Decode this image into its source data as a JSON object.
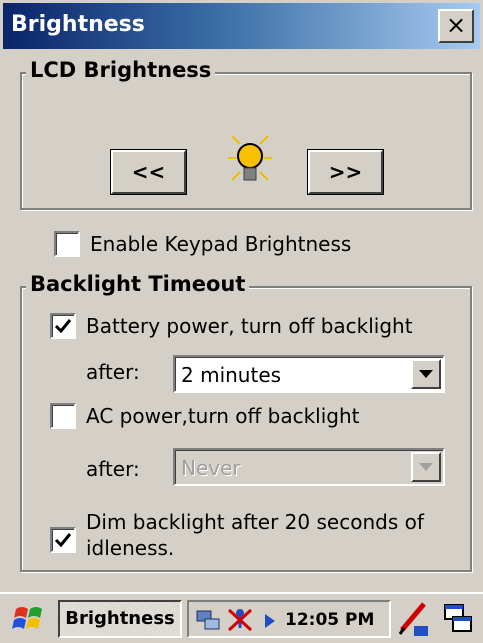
{
  "window": {
    "title": "Brightness",
    "close_label": "×"
  },
  "lcd": {
    "legend": "LCD Brightness",
    "decrease_label": "<<",
    "increase_label": ">>",
    "icon": "lightbulb-icon"
  },
  "keypad": {
    "label": "Enable Keypad Brightness",
    "checked": false
  },
  "backlight": {
    "legend": "Backlight Timeout",
    "battery": {
      "label": "Battery power, turn off backlight",
      "checked": true,
      "after_label": "after:",
      "value": "2 minutes"
    },
    "ac": {
      "label": "AC  power,turn off backlight",
      "checked": false,
      "after_label": "after:",
      "value": "Never"
    },
    "dim": {
      "label_line1": "Dim backlight after 20 seconds of",
      "label_line2": "idleness.",
      "checked": true
    }
  },
  "taskbar": {
    "start_icon": "windows-flag-icon",
    "active_task": "Brightness",
    "time": "12:05 PM",
    "tray_icons": [
      "network-icon",
      "disconnected-icon",
      "arrow-icon"
    ],
    "input_icon": "pen-input-icon",
    "switch_icon": "switch-windows-icon"
  }
}
